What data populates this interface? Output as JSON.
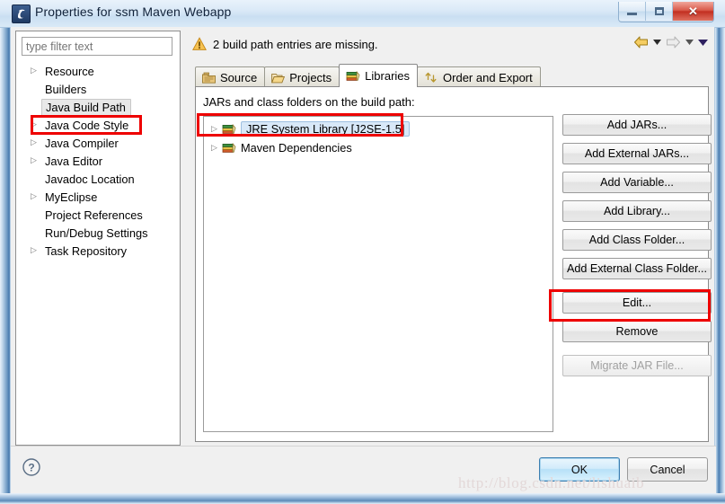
{
  "window": {
    "title": "Properties for ssm Maven Webapp",
    "app_icon": "eclipse-icon",
    "controls": {
      "minimize": "minimize-button",
      "maximize": "maximize-button",
      "close": "close-button"
    }
  },
  "sidebar": {
    "filter": {
      "placeholder": "type filter text",
      "value": ""
    },
    "items": [
      {
        "label": "Resource",
        "expandable": true,
        "selected": false
      },
      {
        "label": "Builders",
        "expandable": false,
        "selected": false
      },
      {
        "label": "Java Build Path",
        "expandable": false,
        "selected": true
      },
      {
        "label": "Java Code Style",
        "expandable": true,
        "selected": false
      },
      {
        "label": "Java Compiler",
        "expandable": true,
        "selected": false
      },
      {
        "label": "Java Editor",
        "expandable": true,
        "selected": false
      },
      {
        "label": "Javadoc Location",
        "expandable": false,
        "selected": false
      },
      {
        "label": "MyEclipse",
        "expandable": true,
        "selected": false
      },
      {
        "label": "Project References",
        "expandable": false,
        "selected": false
      },
      {
        "label": "Run/Debug Settings",
        "expandable": false,
        "selected": false
      },
      {
        "label": "Task Repository",
        "expandable": true,
        "selected": false
      }
    ]
  },
  "warning": {
    "icon": "warning-icon",
    "message": "2 build path entries are missing."
  },
  "navigation": {
    "back": "back-arrow-icon",
    "back_menu": "back-dropdown-icon",
    "forward": "forward-arrow-icon",
    "forward_menu": "forward-dropdown-icon",
    "view_menu": "view-menu-icon"
  },
  "tabs": [
    {
      "label": "Source",
      "icon": "source-folder-icon",
      "active": false
    },
    {
      "label": "Projects",
      "icon": "projects-folder-icon",
      "active": false
    },
    {
      "label": "Libraries",
      "icon": "libraries-books-icon",
      "active": true
    },
    {
      "label": "Order and Export",
      "icon": "order-export-icon",
      "active": false
    }
  ],
  "libraries_tab": {
    "hint": "JARs and class folders on the build path:",
    "hint_mnemonic": "h",
    "entries": [
      {
        "label": "JRE System Library [J2SE-1.5]",
        "icon": "library-icon",
        "expandable": true,
        "selected": true
      },
      {
        "label": "Maven Dependencies",
        "icon": "library-icon",
        "expandable": true,
        "selected": false
      }
    ],
    "buttons": [
      {
        "label": "Add JARs...",
        "mnemonic": "J",
        "enabled": true,
        "highlighted": false
      },
      {
        "label": "Add External JARs...",
        "mnemonic": "x",
        "enabled": true,
        "highlighted": false
      },
      {
        "label": "Add Variable...",
        "mnemonic": "V",
        "enabled": true,
        "highlighted": false
      },
      {
        "label": "Add Library...",
        "mnemonic": "a",
        "enabled": true,
        "highlighted": false
      },
      {
        "label": "Add Class Folder...",
        "mnemonic": "C",
        "enabled": true,
        "highlighted": false
      },
      {
        "label": "Add External Class Folder...",
        "mnemonic": "d",
        "enabled": true,
        "highlighted": false
      },
      {
        "label": "Edit...",
        "mnemonic": "E",
        "enabled": true,
        "highlighted": true
      },
      {
        "label": "Remove",
        "mnemonic": "R",
        "enabled": true,
        "highlighted": false
      },
      {
        "label": "Migrate JAR File...",
        "mnemonic": "i",
        "enabled": false,
        "highlighted": false
      }
    ]
  },
  "footer": {
    "help": "help-icon",
    "ok_label": "OK",
    "cancel_label": "Cancel"
  },
  "watermark": "http://blog.csdn.net/lishuaib",
  "colors": {
    "annotation": "#ee0000",
    "selection": "#d8e8f8",
    "title_text": "#11223a",
    "default_button_border": "#3c7fb1"
  }
}
